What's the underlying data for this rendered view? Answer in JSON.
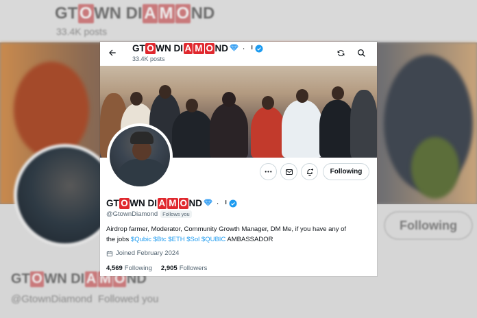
{
  "profile": {
    "name_parts": [
      "GT",
      "O",
      "WN DI",
      "A",
      "M",
      "O",
      "ND"
    ],
    "name_suffix": "ᆞ!",
    "posts_count": "33.4K posts",
    "handle": "@GtownDiamond",
    "follows_you": "Follows you",
    "bio_line1": "Airdrop farmer, Moderator, Community Growth Manager, DM Me, if you have any of",
    "bio_line2_prefix": "the jobs ",
    "bio_tags": [
      "$Qubic",
      "$Btc",
      "$ETH",
      "$Sol",
      "$QUBIC"
    ],
    "bio_line2_suffix": " AMBASSADOR",
    "joined": "Joined February 2024",
    "following_count": "4,569",
    "following_label": "Following",
    "followers_count": "2,905",
    "followers_label": "Followers",
    "follow_button": "Following"
  },
  "background": {
    "name_parts": [
      "GT",
      "O",
      "WN DI",
      "A",
      "M",
      "O",
      "ND"
    ],
    "posts_count": "33.4K posts",
    "handle": "@GtownDiamond",
    "follows_you": "Followed you",
    "follow_button": "Following"
  },
  "icons": {
    "back": "arrow-left-icon",
    "refresh": "refresh-icon",
    "search": "search-icon",
    "more": "more-icon",
    "message": "mail-icon",
    "subscribe": "bell-plus-icon",
    "calendar": "calendar-icon",
    "verified": "verified-badge-icon",
    "gem": "gem-icon"
  },
  "colors": {
    "name_box": "#e0282e",
    "link": "#1d9bf0",
    "verified": "#1d9bf0",
    "text_secondary": "#536471"
  }
}
